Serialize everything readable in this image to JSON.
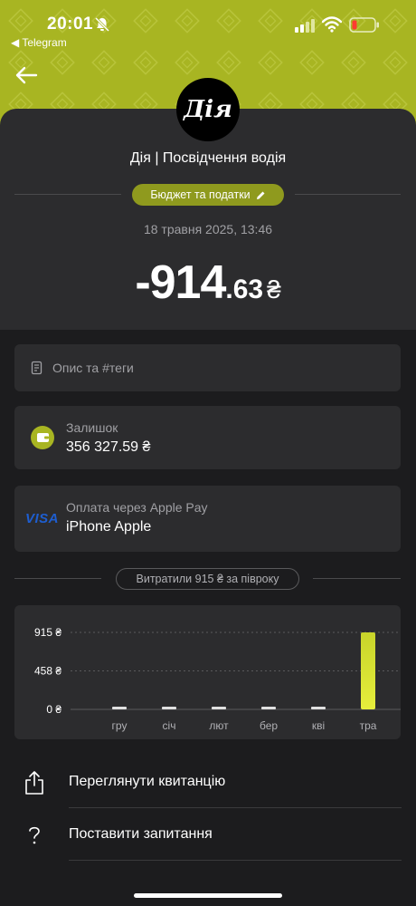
{
  "status_bar": {
    "time": "20:01",
    "back_app": "◀ Telegram"
  },
  "header": {
    "logo_text": "Дія",
    "merchant": "Дія | Посвідчення водія",
    "category": "Бюджет та податки",
    "date": "18 травня 2025, 13:46",
    "amount_main": "-914",
    "amount_decimal": ".63",
    "currency": "₴"
  },
  "description": {
    "placeholder": "Опис та #теги"
  },
  "balance": {
    "label": "Залишок",
    "value": "356 327.59 ₴"
  },
  "payment": {
    "card_brand": "VISA",
    "label": "Оплата через Apple Pay",
    "value": "iPhone Apple"
  },
  "spending": {
    "summary": "Витратили 915 ₴ за півроку"
  },
  "chart_data": {
    "type": "bar",
    "categories": [
      "гру",
      "січ",
      "лют",
      "бер",
      "кві",
      "тра"
    ],
    "values": [
      0,
      0,
      0,
      0,
      0,
      915
    ],
    "ylim": [
      0,
      915
    ],
    "yticks": [
      "915 ₴",
      "458 ₴",
      "0 ₴"
    ],
    "ytick_values": [
      915,
      458,
      0
    ],
    "grid": true,
    "colors": {
      "bar": "#c8d42a",
      "bar_highlight": "#e6ee3c",
      "empty_bar": "#e0e0e0"
    }
  },
  "actions": [
    {
      "label": "Переглянути квитанцію",
      "icon": "share-icon"
    },
    {
      "label": "Поставити запитання",
      "icon": "question-icon"
    }
  ],
  "colors": {
    "accent": "#a8b522",
    "background": "#1c1c1e",
    "card": "#2c2c2e",
    "visa": "#1e5ed0"
  }
}
